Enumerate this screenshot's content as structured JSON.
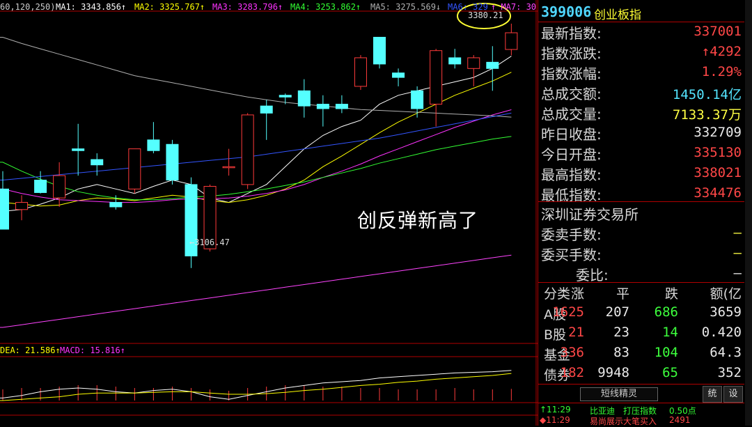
{
  "legend_top": [
    {
      "text": "60,120,250)",
      "color": "#cccccc"
    },
    {
      "text": "MA1: 3343.856↑",
      "color": "#ffffff"
    },
    {
      "text": "MA2: 3325.767↑",
      "color": "#ffff00"
    },
    {
      "text": "MA3: 3283.796↑",
      "color": "#ff33ff"
    },
    {
      "text": "MA4: 3253.862↑",
      "color": "#33ff33"
    },
    {
      "text": "MA5: 3275.569↓",
      "color": "#b0b0b0"
    },
    {
      "text": "MA6: 329",
      "color": "#3355ff"
    },
    {
      "text": "↑ MA7: 30",
      "color": "#ff44ff"
    }
  ],
  "legend_macd": [
    {
      "text": "DEA: 21.586↑",
      "color": "#ffff00"
    },
    {
      "text": "MACD: 15.816↑",
      "color": "#ff33ff"
    }
  ],
  "price_labels": {
    "high": "3380.21",
    "low": "←3106.47"
  },
  "annotation": "创反弹新高了",
  "panel": {
    "code": "399006",
    "name": "创业板指",
    "rows": [
      {
        "label": "最新指数:",
        "value": "337001",
        "color": "red"
      },
      {
        "label": "指数涨跌:",
        "value": "↑4292",
        "color": "red"
      },
      {
        "label": "指数涨幅:",
        "value": "1.29%",
        "color": "red"
      },
      {
        "label": "总成交额:",
        "value": "1450.14亿",
        "color": "cyan"
      },
      {
        "label": "总成交量:",
        "value": "7133.37万",
        "color": "yellow"
      },
      {
        "label": "昨日收盘:",
        "value": "332709",
        "color": "white"
      },
      {
        "label": "今日开盘:",
        "value": "335130",
        "color": "red"
      },
      {
        "label": "最高指数:",
        "value": "338021",
        "color": "red"
      },
      {
        "label": "最低指数:",
        "value": "334476",
        "color": "red"
      }
    ],
    "exchange": "深圳证券交易所",
    "rows2": [
      {
        "label": "委卖手数:",
        "value": "—",
        "color": "yellow"
      },
      {
        "label": "委买手数:",
        "value": "—",
        "color": "yellow"
      },
      {
        "label": "委比:",
        "value": "—",
        "color": "white"
      }
    ],
    "table": {
      "headers": [
        "分类",
        "涨",
        "平",
        "跌",
        "额(亿"
      ],
      "rows": [
        [
          "A股",
          "1625",
          "207",
          "686",
          "3659"
        ],
        [
          "B股",
          "21",
          "23",
          "14",
          "0.420"
        ],
        [
          "基金",
          "336",
          "83",
          "104",
          "64.3"
        ],
        [
          "债券",
          "182",
          "9948",
          "65",
          "352"
        ]
      ]
    },
    "button_label": "短线精灵",
    "btn_a": "统",
    "btn_b": "设",
    "news": [
      {
        "time": "↑11:29",
        "name": "比亚迪",
        "event": "打压指数",
        "value": "0.50点",
        "color": "#33ff33"
      },
      {
        "time": "◆11:29",
        "name": "易尚展示",
        "event": "大笔买入",
        "value": "2491",
        "color": "#ff4747"
      }
    ]
  },
  "chart_data": {
    "type": "candlestick",
    "instrument": "399006 创业板指",
    "candles": [
      {
        "o": 3195,
        "h": 3215,
        "l": 3150,
        "c": 3150
      },
      {
        "o": 3172,
        "h": 3188,
        "l": 3160,
        "c": 3180
      },
      {
        "o": 3205,
        "h": 3215,
        "l": 3190,
        "c": 3191
      },
      {
        "o": 3185,
        "h": 3225,
        "l": 3175,
        "c": 3210
      },
      {
        "o": 3240,
        "h": 3268,
        "l": 3210,
        "c": 3238
      },
      {
        "o": 3228,
        "h": 3235,
        "l": 3210,
        "c": 3222
      },
      {
        "o": 3180,
        "h": 3188,
        "l": 3172,
        "c": 3175
      },
      {
        "o": 3195,
        "h": 3240,
        "l": 3190,
        "c": 3240
      },
      {
        "o": 3250,
        "h": 3270,
        "l": 3235,
        "c": 3238
      },
      {
        "o": 3245,
        "h": 3250,
        "l": 3200,
        "c": 3205
      },
      {
        "o": 3200,
        "h": 3208,
        "l": 3106.47,
        "c": 3120
      },
      {
        "o": 3128,
        "h": 3200,
        "l": 3125,
        "c": 3198
      },
      {
        "o": 3220,
        "h": 3240,
        "l": 3210,
        "c": 3220
      },
      {
        "o": 3200,
        "h": 3280,
        "l": 3195,
        "c": 3278
      },
      {
        "o": 3288,
        "h": 3295,
        "l": 3250,
        "c": 3280
      },
      {
        "o": 3300,
        "h": 3302,
        "l": 3290,
        "c": 3298
      },
      {
        "o": 3305,
        "h": 3318,
        "l": 3275,
        "c": 3288
      },
      {
        "o": 3290,
        "h": 3300,
        "l": 3265,
        "c": 3285
      },
      {
        "o": 3290,
        "h": 3300,
        "l": 3280,
        "c": 3285
      },
      {
        "o": 3310,
        "h": 3345,
        "l": 3306,
        "c": 3342
      },
      {
        "o": 3365,
        "h": 3365,
        "l": 3330,
        "c": 3335
      },
      {
        "o": 3325,
        "h": 3330,
        "l": 3310,
        "c": 3320
      },
      {
        "o": 3305,
        "h": 3310,
        "l": 3275,
        "c": 3285
      },
      {
        "o": 3290,
        "h": 3352,
        "l": 3265,
        "c": 3350
      },
      {
        "o": 3342,
        "h": 3352,
        "l": 3330,
        "c": 3335
      },
      {
        "o": 3330,
        "h": 3345,
        "l": 3310,
        "c": 3342
      },
      {
        "o": 3337,
        "h": 3355,
        "l": 3305,
        "c": 3330
      },
      {
        "o": 3351.3,
        "h": 3380.21,
        "l": 3344.76,
        "c": 3370.01
      }
    ],
    "ma_lines": [
      {
        "name": "MA1",
        "color": "#ffffff",
        "values": [
          3170,
          3172,
          3178,
          3185,
          3195,
          3200,
          3195,
          3190,
          3198,
          3205,
          3200,
          3185,
          3180,
          3190,
          3200,
          3220,
          3240,
          3255,
          3265,
          3272,
          3290,
          3300,
          3305,
          3310,
          3315,
          3320,
          3330,
          3343.856
        ]
      },
      {
        "name": "MA2",
        "color": "#ffff00",
        "values": [
          3180,
          3178,
          3176,
          3177,
          3182,
          3185,
          3184,
          3182,
          3185,
          3188,
          3186,
          3182,
          3180,
          3183,
          3188,
          3195,
          3205,
          3220,
          3232,
          3245,
          3258,
          3270,
          3280,
          3290,
          3300,
          3308,
          3316,
          3325.767
        ]
      },
      {
        "name": "MA3",
        "color": "#ff33ff",
        "values": [
          3195,
          3190,
          3186,
          3183,
          3182,
          3181,
          3180,
          3180,
          3181,
          3183,
          3184,
          3184,
          3185,
          3187,
          3190,
          3194,
          3200,
          3208,
          3215,
          3223,
          3232,
          3240,
          3248,
          3256,
          3264,
          3271,
          3278,
          3283.796
        ]
      },
      {
        "name": "MA4",
        "color": "#33ff33",
        "values": [
          3225,
          3215,
          3206,
          3198,
          3192,
          3188,
          3185,
          3183,
          3183,
          3184,
          3186,
          3187,
          3189,
          3192,
          3195,
          3199,
          3203,
          3208,
          3213,
          3218,
          3224,
          3229,
          3234,
          3239,
          3243,
          3247,
          3251,
          3253.862
        ]
      },
      {
        "name": "MA5",
        "color": "#b0b0b0",
        "values": [
          3365,
          3358,
          3352,
          3346,
          3340,
          3334,
          3328,
          3322,
          3318,
          3314,
          3310,
          3306,
          3302,
          3298,
          3295,
          3292,
          3290,
          3288,
          3286,
          3284,
          3283,
          3282,
          3281,
          3280,
          3279,
          3278,
          3277,
          3275.569
        ]
      },
      {
        "name": "MA6",
        "color": "#3355ff",
        "values": [
          3205,
          3207,
          3209,
          3211,
          3213,
          3215,
          3217,
          3219,
          3221,
          3223,
          3225,
          3227,
          3229,
          3231,
          3234,
          3237,
          3240,
          3243,
          3246,
          3249,
          3252,
          3256,
          3260,
          3264,
          3268,
          3272,
          3276,
          3280
        ]
      },
      {
        "name": "MA7",
        "color": "#ff44ff",
        "values": [
          3040,
          3043,
          3046,
          3049,
          3052,
          3055,
          3058,
          3061,
          3064,
          3067,
          3070,
          3073,
          3076,
          3079,
          3082,
          3085,
          3088,
          3091,
          3094,
          3097,
          3100,
          3103,
          3106,
          3109,
          3112,
          3115,
          3118,
          3121
        ]
      }
    ],
    "macd": {
      "dif": [
        2,
        4,
        7,
        9,
        10,
        9,
        7,
        6,
        8,
        9,
        7,
        3,
        1,
        4,
        7,
        10,
        12,
        14,
        15,
        16,
        18,
        19,
        20,
        21,
        22,
        22.5,
        23,
        24
      ],
      "dea": [
        0,
        1,
        2,
        3,
        5,
        6,
        6,
        6,
        6.5,
        7,
        7,
        6,
        5,
        5,
        5.5,
        6.5,
        8,
        9,
        10.5,
        12,
        13,
        14.5,
        15.5,
        17,
        18,
        19,
        20,
        21.586
      ],
      "bars": [
        2,
        3,
        3,
        4,
        5,
        5,
        4,
        3,
        3,
        4,
        3,
        2,
        1,
        3,
        4,
        5,
        5,
        4,
        4,
        3,
        3,
        2,
        2,
        2,
        3,
        2,
        2,
        15.816
      ]
    }
  }
}
